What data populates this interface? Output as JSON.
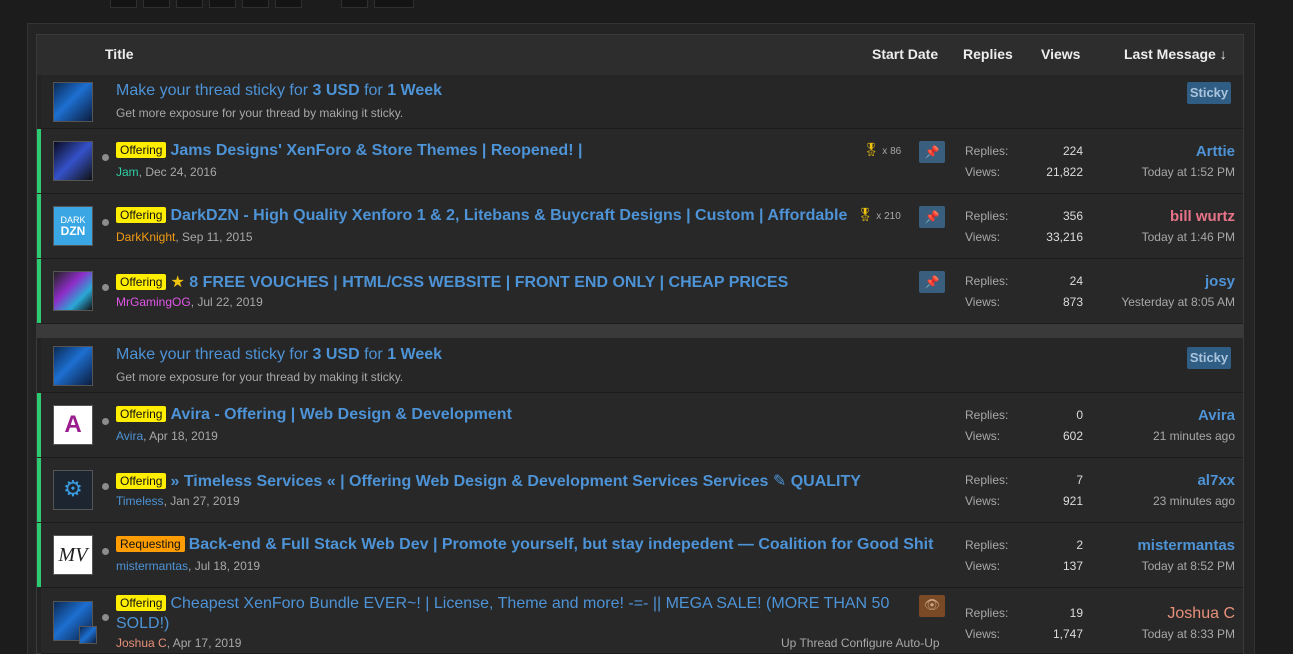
{
  "header": {
    "title": "Title",
    "start_date": "Start Date",
    "replies": "Replies",
    "views": "Views",
    "last_message": "Last Message",
    "sort_arrow": "↓"
  },
  "promo": {
    "text_a": "Make your thread sticky for ",
    "price": "3 USD",
    "text_b": " for ",
    "duration": "1 Week",
    "subtitle": "Get more exposure for your thread by making it sticky.",
    "badge": "Sticky"
  },
  "labels": {
    "replies": "Replies:",
    "views": "Views:"
  },
  "threads": [
    {
      "prefix": "Offering",
      "title": "Jams Designs' XenForo & Store Themes | Reopened! |",
      "author": "Jam",
      "author_color": "#2ecfa4",
      "date": ", Dec 24, 2016",
      "trophy": "x 86",
      "replies": "224",
      "views": "21,822",
      "last_user": "Arttie",
      "last_user_color": "#4d93d6",
      "last_time": "Today at 1:52 PM"
    },
    {
      "prefix": "Offering",
      "title": "DarkDZN - High Quality Xenforo 1 & 2, Litebans & Buycraft Designs | Custom | Affordable",
      "author": "DarkKnight",
      "author_color": "#f39c12",
      "date": ", Sep 11, 2015",
      "trophy": "x 210",
      "replies": "356",
      "views": "33,216",
      "last_user": "bill wurtz",
      "last_user_color": "#e8748a",
      "last_time": "Today at 1:46 PM"
    },
    {
      "prefix": "Offering",
      "title": "8 FREE VOUCHES | HTML/CSS WEBSITE | FRONT END ONLY | CHEAP PRICES",
      "author": "MrGamingOG",
      "author_color": "#e056e8",
      "date": ", Jul 22, 2019",
      "replies": "24",
      "views": "873",
      "last_user": "josy",
      "last_user_color": "#4d93d6",
      "last_time": "Yesterday at 8:05 AM"
    },
    {
      "prefix": "Offering",
      "title": "Avira - Offering | Web Design & Development",
      "author": "Avira",
      "author_color": "#4d93d6",
      "date": ", Apr 18, 2019",
      "replies": "0",
      "views": "602",
      "last_user": "Avira",
      "last_user_color": "#4d93d6",
      "last_time": "21 minutes ago"
    },
    {
      "prefix": "Offering",
      "title": "» Timeless Services « | Offering Web Design & Development Services Services",
      "title_suffix": " QUALITY",
      "author": "Timeless",
      "author_color": "#4d93d6",
      "date": ", Jan 27, 2019",
      "replies": "7",
      "views": "921",
      "last_user": "al7xx",
      "last_user_color": "#4d93d6",
      "last_time": "23 minutes ago"
    },
    {
      "prefix": "Requesting",
      "title": "Back-end & Full Stack Web Dev | Promote yourself, but stay indepedent — Coalition for Good Shit",
      "author": "mistermantas",
      "author_color": "#4d93d6",
      "date": ", Jul 18, 2019",
      "replies": "2",
      "views": "137",
      "last_user": "mistermantas",
      "last_user_color": "#4d93d6",
      "last_time": "Today at 8:52 PM"
    },
    {
      "prefix": "Offering",
      "title_line1": "Cheapest XenForo Bundle EVER~! | License, Theme and more! -=- || MEGA SALE! (MORE THAN 50",
      "title_line2": "SOLD!)",
      "author": "Joshua C",
      "author_color": "#e8907a",
      "date": ", Apr 17, 2019",
      "up_thread": "Up Thread",
      "configure": "Configure Auto-Up",
      "replies": "19",
      "views": "1,747",
      "last_user": "Joshua C",
      "last_user_color": "#e8907a",
      "last_time": "Today at 8:33 PM"
    }
  ],
  "avatars": {
    "dzn_line1": "DARK",
    "dzn_line2": "DZN",
    "avira": "A",
    "mv": "MV"
  },
  "icons": {
    "trophy": "trophy-icon",
    "pin": "pin-icon",
    "eye": "eye-icon",
    "star": "star-icon",
    "pencil": "pencil-icon",
    "gear": "gear-icon"
  }
}
